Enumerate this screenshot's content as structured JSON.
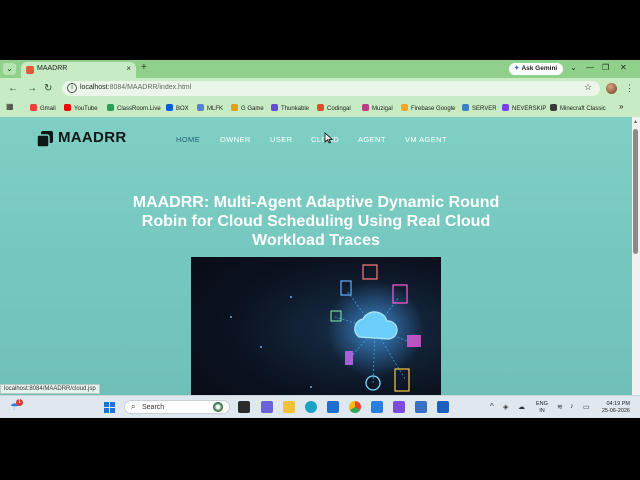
{
  "browser": {
    "tab_title": "MAADRR",
    "tab_close": "×",
    "new_tab": "+",
    "gemini_label": "Ask Gemini",
    "window_controls": [
      "⌄",
      "—",
      "❐",
      "✕"
    ],
    "url_host": "localhost",
    "url_rest": ":8084/MAADRR/index.html",
    "status_url": "localhost:8084/MAADRR/cloud.jsp",
    "bookmarks": [
      {
        "label": "Gmail",
        "color": "#ea4335"
      },
      {
        "label": "YouTube",
        "color": "#ff0000"
      },
      {
        "label": "ClassRoom.Live",
        "color": "#2f9d5a"
      },
      {
        "label": "BOX",
        "color": "#0061d5"
      },
      {
        "label": "MLFK",
        "color": "#5b7fd9"
      },
      {
        "label": "G Game",
        "color": "#e0a11b"
      },
      {
        "label": "Thunkable",
        "color": "#6a4bd6"
      },
      {
        "label": "Codingal",
        "color": "#e0502d"
      },
      {
        "label": "Muzigal",
        "color": "#c33a8c"
      },
      {
        "label": "Firebase Google",
        "color": "#f5a623"
      },
      {
        "label": "SERVER",
        "color": "#3b82c4"
      },
      {
        "label": "NEVERSKIP",
        "color": "#7b3fe4"
      },
      {
        "label": "Minecraft Classic",
        "color": "#3a3a3a"
      }
    ]
  },
  "site": {
    "logo": "MAADRR",
    "nav": [
      {
        "label": "HOME",
        "active": true
      },
      {
        "label": "OWNER",
        "active": false
      },
      {
        "label": "USER",
        "active": false
      },
      {
        "label": "CLOUD",
        "active": false
      },
      {
        "label": "AGENT",
        "active": false
      },
      {
        "label": "VM AGENT",
        "active": false
      }
    ],
    "headline": "MAADRR: Multi-Agent Adaptive Dynamic Round Robin for Cloud Scheduling Using Real Cloud Workload Traces"
  },
  "taskbar": {
    "notification_count": "1",
    "search_placeholder": "Search",
    "lang_top": "ENG",
    "lang_bottom": "IN",
    "time": "04:19 PM",
    "date": "25-06-2026"
  }
}
